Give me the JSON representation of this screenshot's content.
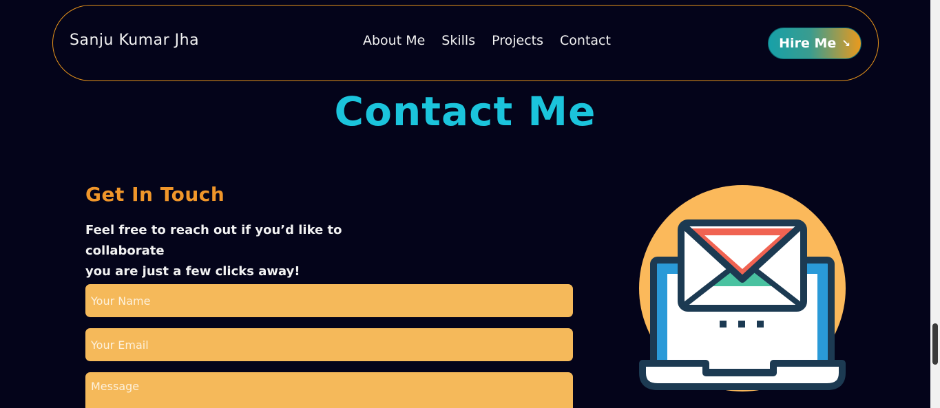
{
  "nav": {
    "brand": "Sanju Kumar Jha",
    "links": [
      "About Me",
      "Skills",
      "Projects",
      "Contact"
    ],
    "hire_label": "Hire Me",
    "hire_icon": "arrow-down-right-icon"
  },
  "contact": {
    "title": "Contact Me",
    "subtitle": "Get In Touch",
    "intro_line1": "Feel free to reach out if you’d like to collaborate",
    "intro_line2": "you are just a few clicks away!",
    "form": {
      "name_placeholder": "Your Name",
      "email_placeholder": "Your Email",
      "message_placeholder": "Message"
    },
    "illustration_icon": "envelope-laptop-icon"
  },
  "colors": {
    "background": "#04041a",
    "accent_orange": "#e8941a",
    "title_cyan": "#1bc4dc",
    "field_fill": "#f5b95a"
  }
}
